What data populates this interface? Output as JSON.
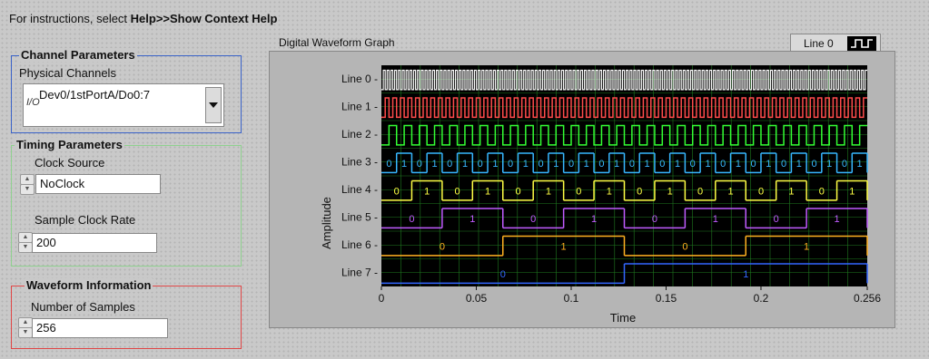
{
  "instructions": {
    "prefix": "For instructions, select ",
    "bold": "Help>>Show Context Help"
  },
  "channel_params": {
    "title": "Channel Parameters",
    "physical_channels_label": "Physical Channels",
    "io_glyph": "I/O",
    "physical_channels_value": "Dev0/1stPortA/Do0:7",
    "border_color": "#3a62c8"
  },
  "timing_params": {
    "title": "Timing Parameters",
    "clock_source_label": "Clock Source",
    "clock_source_value": "NoClock",
    "sample_rate_label": "Sample Clock Rate",
    "sample_rate_value": "200",
    "border_color": "#8fd18f"
  },
  "waveform_info": {
    "title": "Waveform Information",
    "num_samples_label": "Number of Samples",
    "num_samples_value": "256",
    "border_color": "#e04646"
  },
  "graph": {
    "title": "Digital Waveform Graph",
    "legend_label": "Line 0",
    "ylabel": "Amplitude",
    "xlabel": "Time",
    "xticks": [
      "0",
      "0.05",
      "0.1",
      "0.15",
      "0.2",
      "0.256"
    ],
    "line_labels": [
      "Line 0 -",
      "Line 1 -",
      "Line 2 -",
      "Line 3 -",
      "Line 4 -",
      "Line 5 -",
      "Line 6 -",
      "Line 7 -"
    ]
  },
  "chart_data": {
    "type": "line",
    "title": "Digital Waveform Graph",
    "xlabel": "Time",
    "ylabel": "Amplitude",
    "xlim": [
      0,
      0.256
    ],
    "xticks": [
      0,
      0.05,
      0.1,
      0.15,
      0.2,
      0.256
    ],
    "sample_interval": 0.001,
    "samples": 256,
    "series": [
      {
        "name": "Line 0",
        "half_period_samples": 1,
        "color": "#ffffff"
      },
      {
        "name": "Line 1",
        "half_period_samples": 2,
        "color": "#ff4b4b"
      },
      {
        "name": "Line 2",
        "half_period_samples": 4,
        "color": "#33ff33"
      },
      {
        "name": "Line 3",
        "half_period_samples": 8,
        "color": "#37b7ff"
      },
      {
        "name": "Line 4",
        "half_period_samples": 16,
        "color": "#ffff44"
      },
      {
        "name": "Line 5",
        "half_period_samples": 32,
        "color": "#c05bff"
      },
      {
        "name": "Line 6",
        "half_period_samples": 64,
        "color": "#ffb020"
      },
      {
        "name": "Line 7",
        "half_period_samples": 128,
        "color": "#3366ff"
      }
    ]
  }
}
